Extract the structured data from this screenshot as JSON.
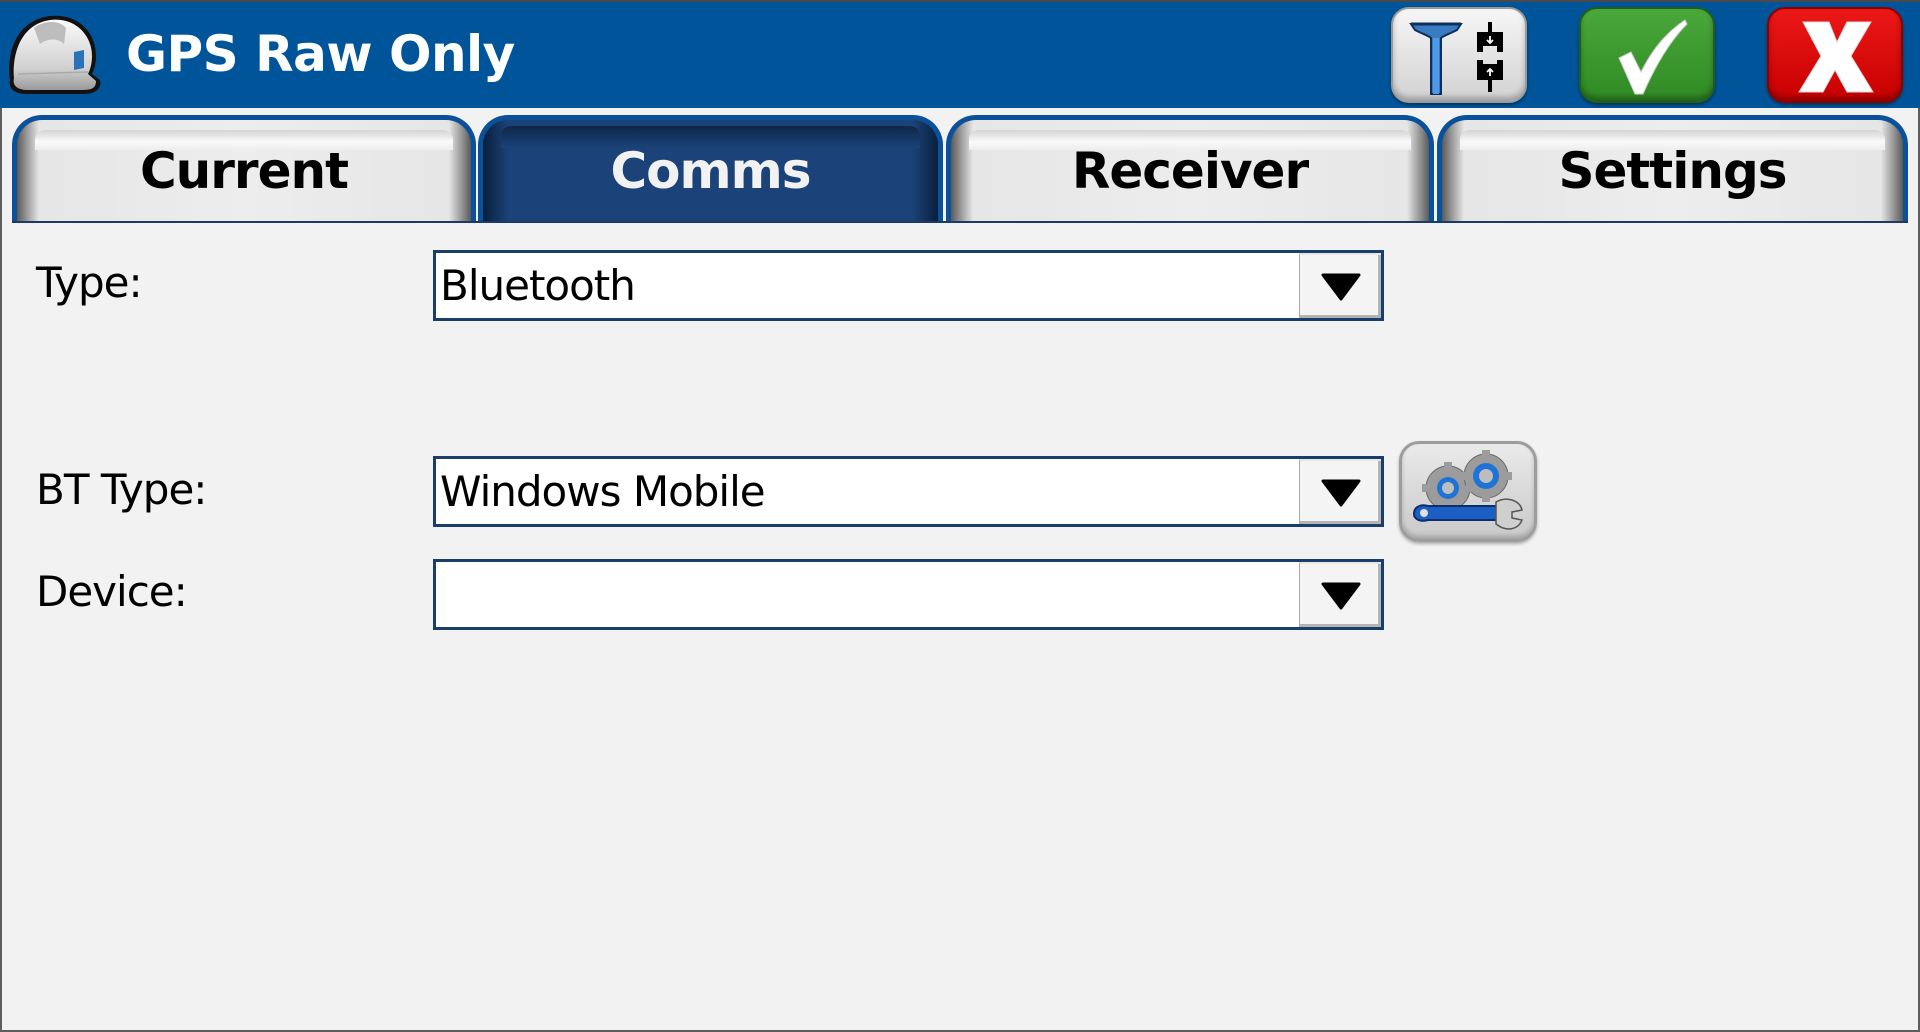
{
  "header": {
    "title": "GPS Raw Only",
    "app_icon": "hard-hat-icon",
    "buttons": [
      {
        "name": "gps-receiver-connect-button",
        "icon": "gps-rover-plug-icon"
      },
      {
        "name": "accept-button",
        "icon": "checkmark-icon"
      },
      {
        "name": "cancel-button",
        "icon": "x-icon"
      }
    ]
  },
  "tabs": [
    {
      "label": "Current",
      "active": false
    },
    {
      "label": "Comms",
      "active": true
    },
    {
      "label": "Receiver",
      "active": false
    },
    {
      "label": "Settings",
      "active": false
    }
  ],
  "form": {
    "type": {
      "label": "Type:",
      "value": "Bluetooth"
    },
    "bt_type": {
      "label": "BT Type:",
      "value": "Windows Mobile"
    },
    "device": {
      "label": "Device:",
      "value": ""
    },
    "config_button_icon": "gears-wrench-icon"
  },
  "colors": {
    "header_bg": "#00559a",
    "active_tab": "#1b4379",
    "accept": "#3a9a2e",
    "cancel": "#dd0000"
  }
}
